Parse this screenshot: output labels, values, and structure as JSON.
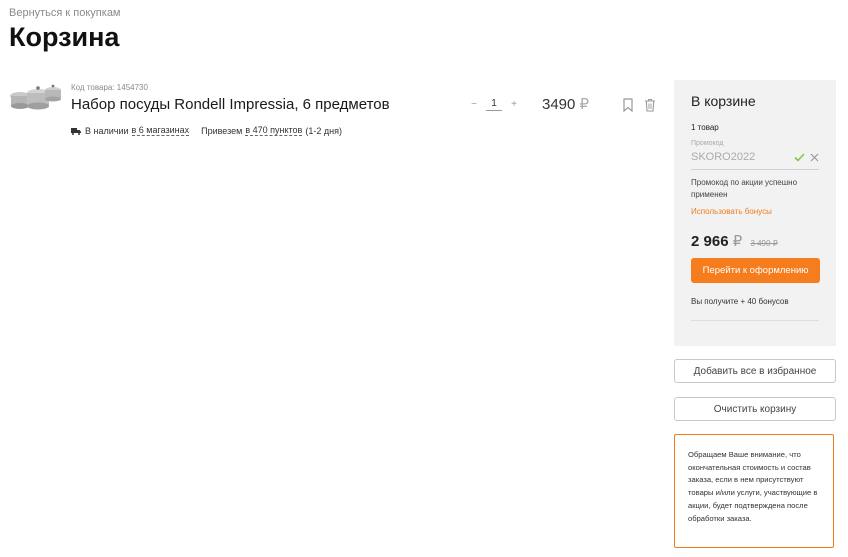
{
  "nav": {
    "back_label": "Вернуться к покупкам"
  },
  "page": {
    "title": "Корзина"
  },
  "cart_item": {
    "sku_label": "Код товара: 1454730",
    "name": "Набор посуды Rondell Impressia, 6 предметов",
    "availability_prefix": "В наличии",
    "availability_link": "в 6 магазинах",
    "delivery_prefix": "Привезем",
    "delivery_link": "в 470 пунктов",
    "delivery_suffix": "(1-2 дня)",
    "qty_minus": "−",
    "qty_value": "1",
    "qty_plus": "+",
    "price": "3490",
    "currency": "₽",
    "icons": [
      "truck-icon",
      "bookmark-icon",
      "trash-icon"
    ]
  },
  "summary": {
    "title": "В корзине",
    "count": "1 товар",
    "promo_label": "Промокод",
    "promo_code": "SKORO2022",
    "promo_applied": "Промокод по акции успешно применен",
    "use_bonus": "Использовать бонусы",
    "total": "2 966",
    "currency": "₽",
    "old_total": "3 490 ₽",
    "checkout_label": "Перейти к оформлению",
    "bonus_info": "Вы получите + 40 бонусов",
    "accent_color": "#f57d1e",
    "success_color": "#8bc34a"
  },
  "actions": {
    "favorite_all": "Добавить все в избранное",
    "clear_cart": "Очистить корзину"
  },
  "notice": {
    "text": "Обращаем Ваше внимание, что окончательная стоимость и состав заказа, если в нем присутствуют товары и/или услуги, участвующие в акции, будет подтверждена после обработки заказа."
  }
}
